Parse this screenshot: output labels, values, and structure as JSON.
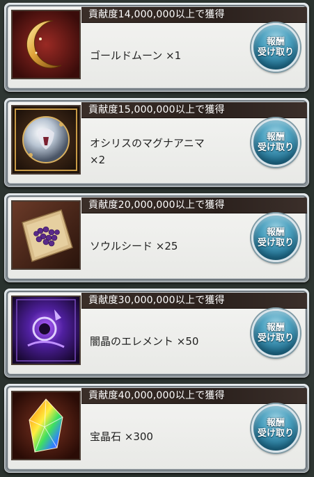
{
  "rewards": [
    {
      "requirement": "貢献度14,000,000以上で獲得",
      "item_name": "ゴールドムーン ×1",
      "item_name_line2": "",
      "icon": "gold-moon-icon",
      "button_line1": "報酬",
      "button_line2": "受け取り"
    },
    {
      "requirement": "貢献度15,000,000以上で獲得",
      "item_name": "オシリスのマグナアニマ",
      "item_name_line2": "×2",
      "icon": "osiris-anima-icon",
      "button_line1": "報酬",
      "button_line2": "受け取り"
    },
    {
      "requirement": "貢献度20,000,000以上で獲得",
      "item_name": "ソウルシード ×25",
      "item_name_line2": "",
      "icon": "soul-seed-icon",
      "button_line1": "報酬",
      "button_line2": "受け取り"
    },
    {
      "requirement": "貢献度30,000,000以上で獲得",
      "item_name": "闇晶のエレメント ×50",
      "item_name_line2": "",
      "icon": "dark-element-icon",
      "button_line1": "報酬",
      "button_line2": "受け取り"
    },
    {
      "requirement": "貢献度40,000,000以上で獲得",
      "item_name": "宝晶石 ×300",
      "item_name_line2": "",
      "icon": "crystal-icon",
      "button_line1": "報酬",
      "button_line2": "受け取り"
    }
  ],
  "colors": {
    "header_band": "#2b211d",
    "button_blue": "#1f6e8f",
    "card_bg": "#f4f4f2"
  }
}
